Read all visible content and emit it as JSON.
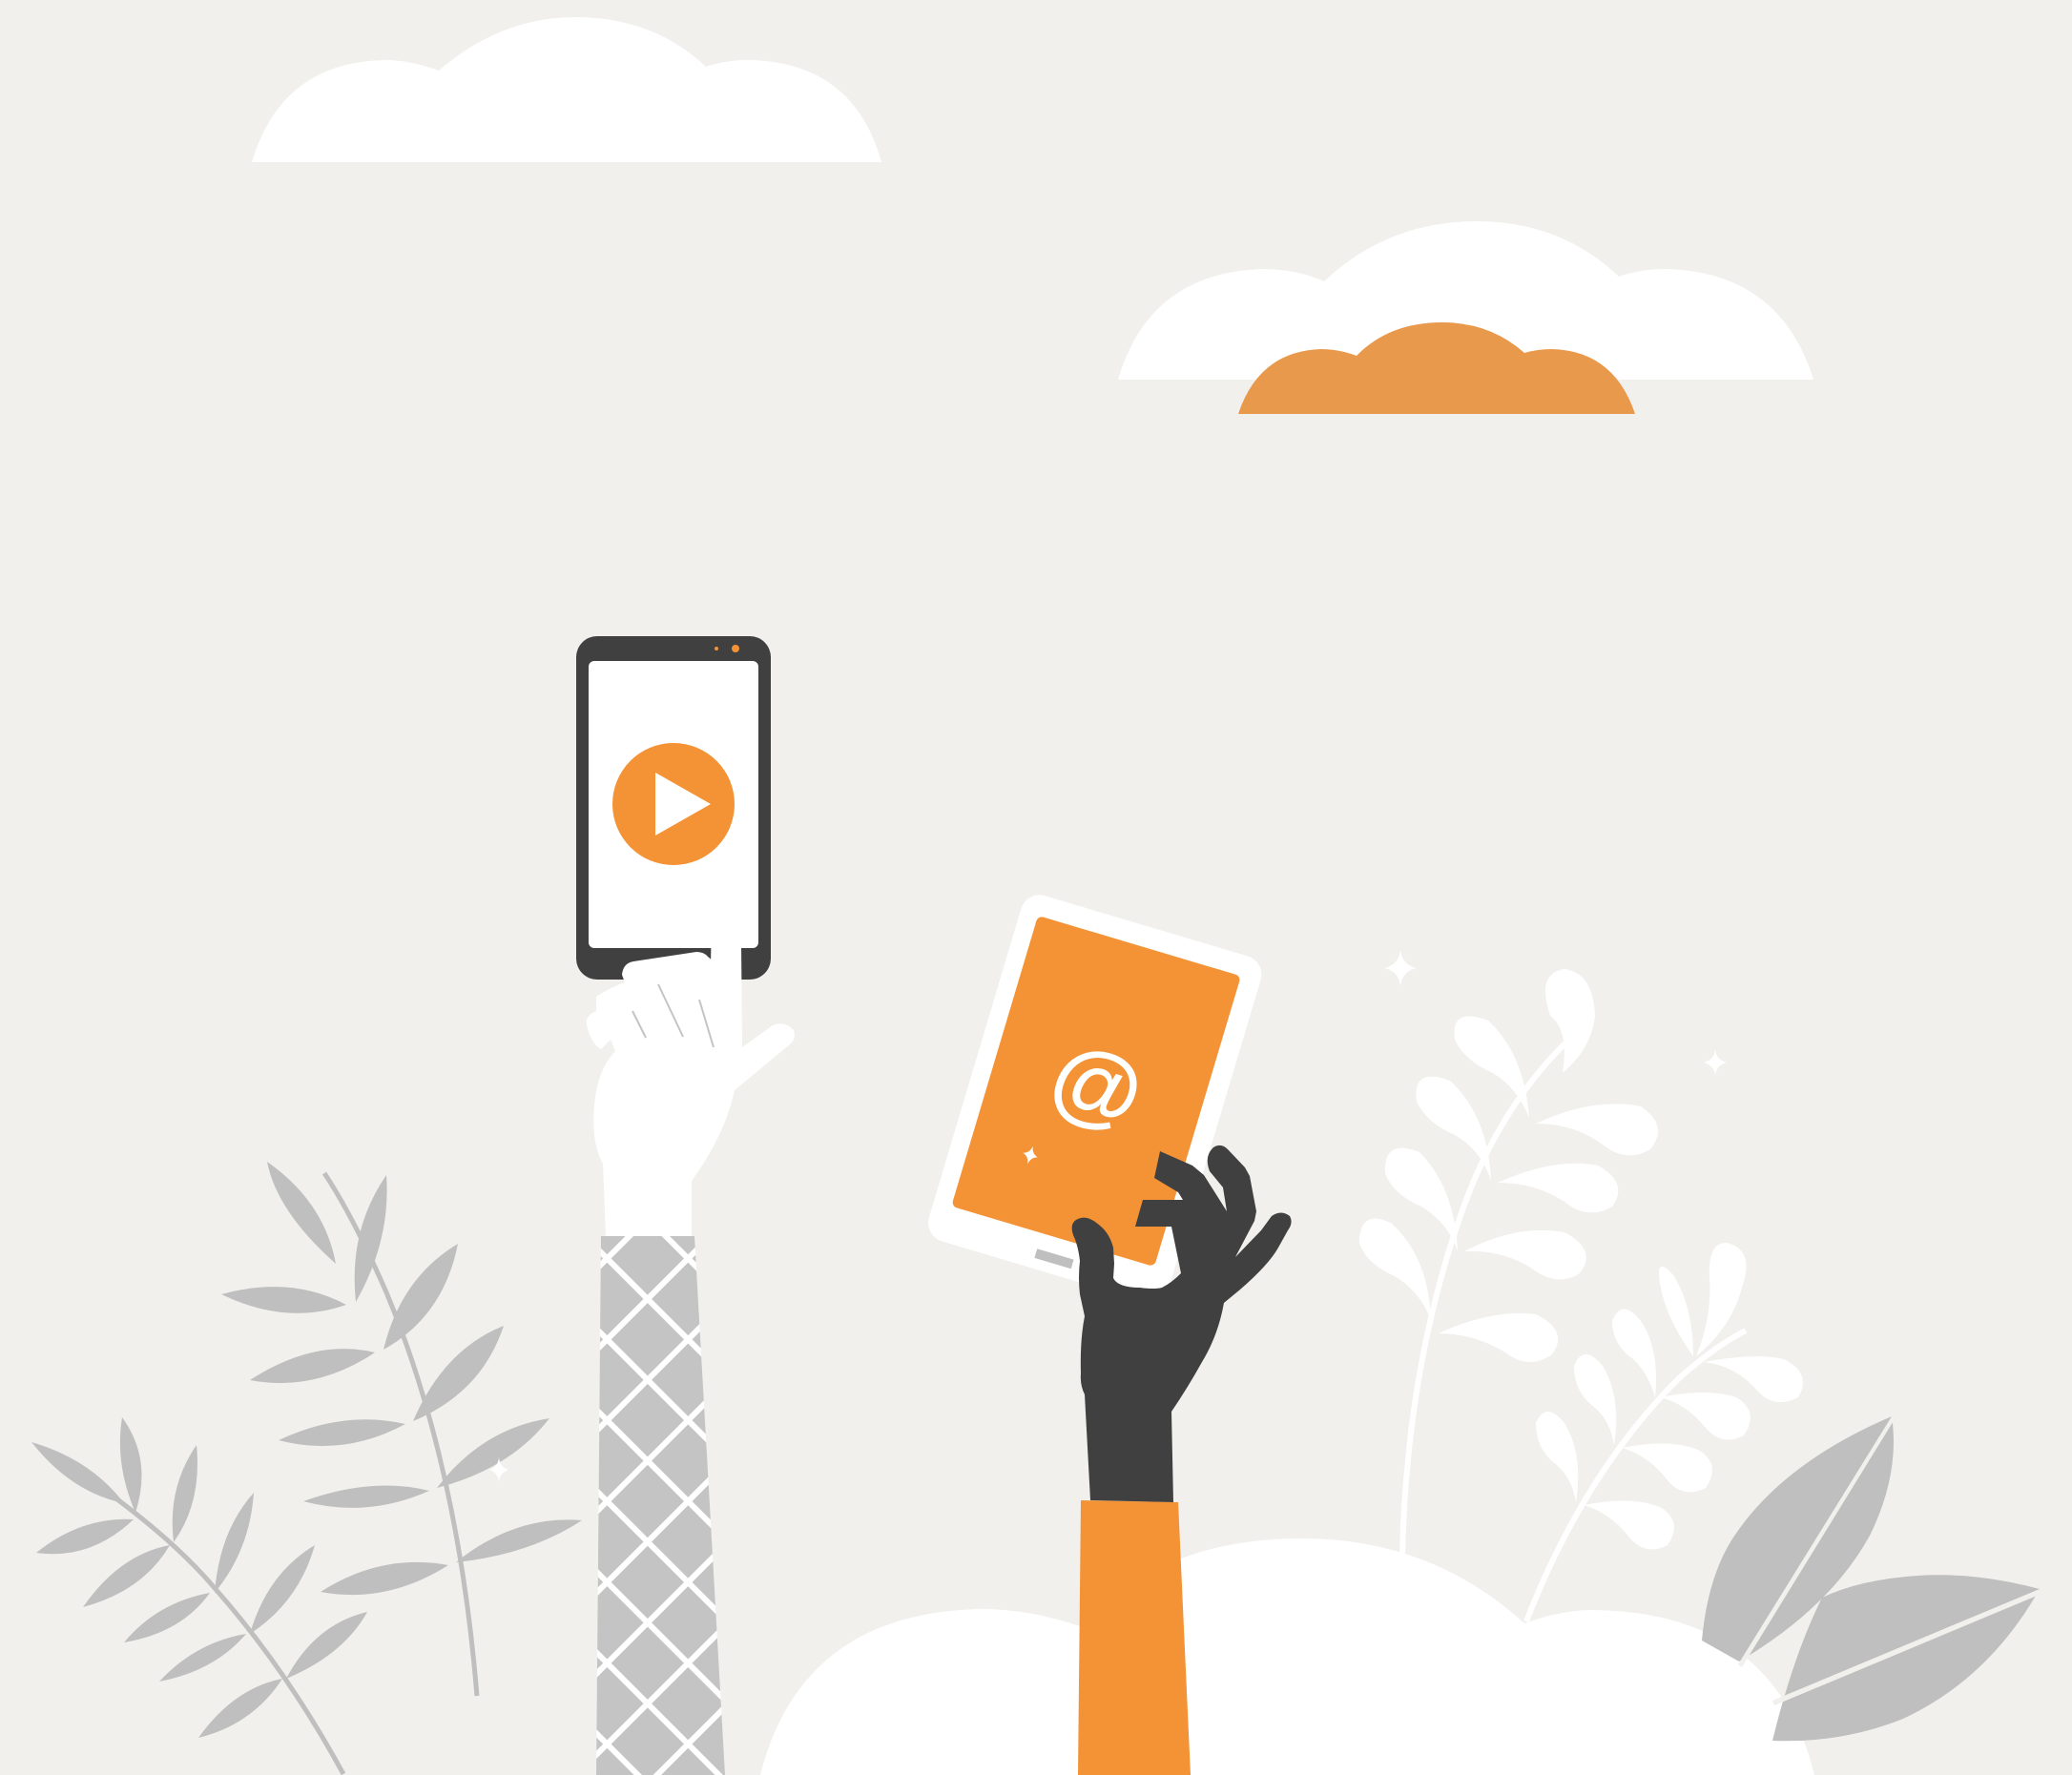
{
  "scene": {
    "description_icons": [
      "play-icon",
      "at-sign-icon",
      "sparkle-icon"
    ],
    "colors": {
      "background": "#f1f0ed",
      "white": "#ffffff",
      "orange": "#f39335",
      "muted_orange": "#e8994b",
      "dark": "#404040",
      "gray_leaf": "#bfbfbf",
      "pattern_gray": "#c4c4c4"
    },
    "left_phone": {
      "screen_icon": "play-icon"
    },
    "right_phone": {
      "screen_icon": "at-sign-icon",
      "symbol": "@"
    }
  }
}
